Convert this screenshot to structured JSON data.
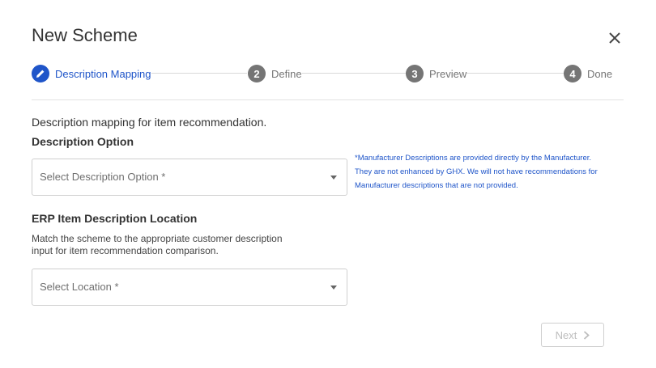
{
  "dialog": {
    "title": "New Scheme"
  },
  "stepper": {
    "steps": [
      {
        "number": "",
        "label": "Description Mapping",
        "state": "active",
        "icon": "pencil-icon"
      },
      {
        "number": "2",
        "label": "Define",
        "state": "inactive"
      },
      {
        "number": "3",
        "label": "Preview",
        "state": "inactive"
      },
      {
        "number": "4",
        "label": "Done",
        "state": "inactive"
      }
    ]
  },
  "content": {
    "intro": "Description mapping for item recommendation.",
    "description_option": {
      "heading": "Description Option",
      "placeholder": "Select Description Option *"
    },
    "manufacturer_note": "*Manufacturer Descriptions are provided directly by the Manufacturer. They are not enhanced by GHX. We will not have recommendations for Manufacturer descriptions that are not provided.",
    "erp_location": {
      "heading": "ERP Item Description Location",
      "help": "Match the scheme to the appropriate customer description input for item recommendation comparison.",
      "placeholder": "Select Location *"
    }
  },
  "footer": {
    "next_label": "Next",
    "next_disabled": true
  },
  "colors": {
    "accent": "#1f55c9",
    "inactive_step": "#757575",
    "disabled_text": "#bdbdbd"
  }
}
